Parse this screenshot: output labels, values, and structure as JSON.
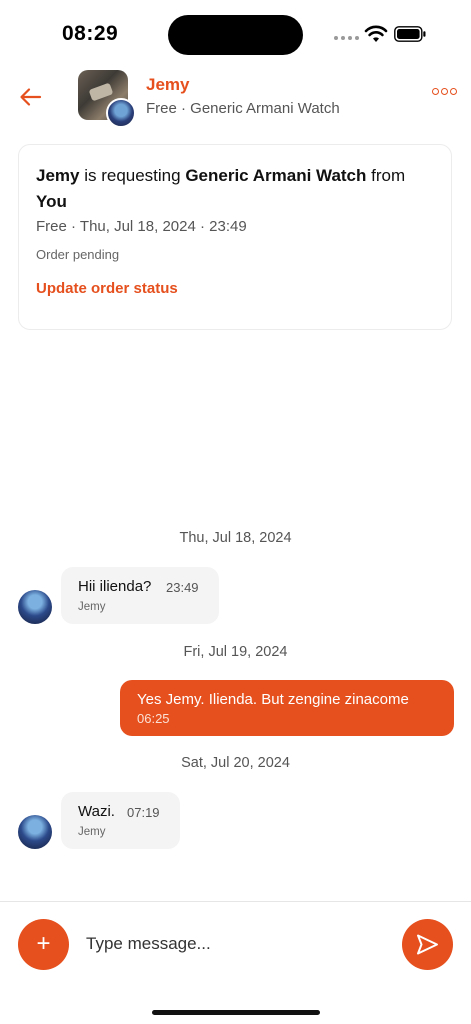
{
  "status_bar": {
    "time": "08:29"
  },
  "header": {
    "name": "Jemy",
    "subtitle": "Free · Generic Armani Watch",
    "back_icon": "arrow-left-icon",
    "more_icon": "more-horizontal-icon"
  },
  "order_card": {
    "requester": "Jemy",
    "text_requesting": " is requesting ",
    "item": "Generic Armani Watch",
    "text_from": " from ",
    "owner": "You",
    "meta": "Free · Thu, Jul 18, 2024 · 23:49",
    "status": "Order pending",
    "action_label": "Update order status"
  },
  "messages": [
    {
      "date": "Thu, Jul 18, 2024",
      "text": "Hii ilienda?",
      "time": "23:49",
      "sender": "Jemy",
      "direction": "incoming"
    },
    {
      "date": "Fri, Jul 19, 2024",
      "text": "Yes Jemy. Ilienda. But zengine zinacome",
      "time": "06:25",
      "direction": "outgoing"
    },
    {
      "date": "Sat, Jul 20, 2024",
      "text": "Wazi.",
      "time": "07:19",
      "sender": "Jemy",
      "direction": "incoming"
    }
  ],
  "composer": {
    "placeholder": "Type message...",
    "add_icon": "plus-icon",
    "send_icon": "send-icon"
  },
  "colors": {
    "accent": "#e5501e",
    "bubble_incoming": "#f4f4f4",
    "text": "#111111"
  }
}
